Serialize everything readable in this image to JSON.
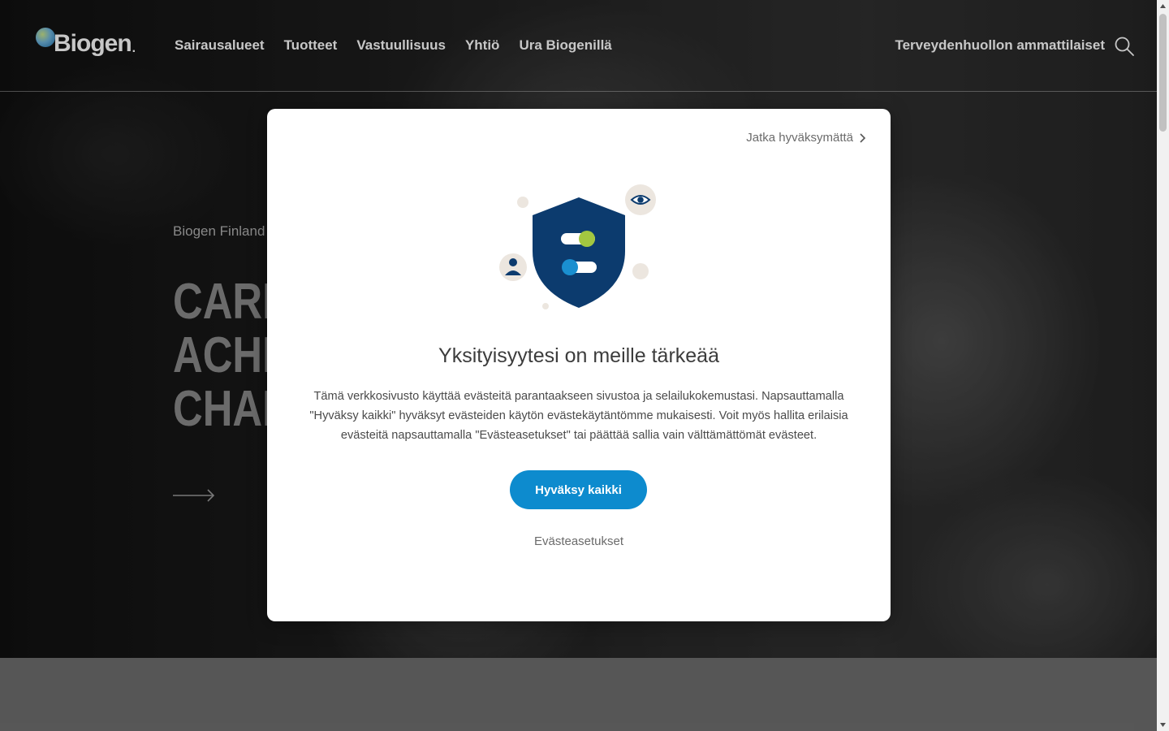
{
  "header": {
    "logo_text": "Biogen",
    "nav": [
      {
        "label": "Sairausalueet"
      },
      {
        "label": "Tuotteet"
      },
      {
        "label": "Vastuullisuus"
      },
      {
        "label": "Yhtiö"
      },
      {
        "label": "Ura Biogenillä"
      }
    ],
    "hcp_link": "Terveydenhuollon ammattilaiset",
    "search_icon": "search-icon"
  },
  "hero": {
    "eyebrow": "Biogen Finland",
    "title_lines": [
      "CARI",
      "ACHI",
      "CHAN"
    ],
    "arrow_icon": "arrow-right-icon"
  },
  "cookie_modal": {
    "skip_link": "Jatka hyväksymättä",
    "title": "Yksityisyytesi on meille tärkeää",
    "body": "Tämä verkkosivusto käyttää evästeitä parantaakseen sivustoa ja selailukokemustasi. Napsauttamalla \"Hyväksy kaikki\" hyväksyt evästeiden käytön evästekäytäntömme mukaisesti.  Voit myös hallita erilaisia evästeitä napsauttamalla \"Evästeasetukset\" tai päättää sallia vain välttämättömät evästeet.",
    "accept_button": "Hyväksy kaikki",
    "settings_link": "Evästeasetukset",
    "colors": {
      "accent": "#0d8bce",
      "shield": "#0c3b6e",
      "toggle_green": "#a3c740",
      "toggle_blue": "#1a8fd0"
    }
  }
}
